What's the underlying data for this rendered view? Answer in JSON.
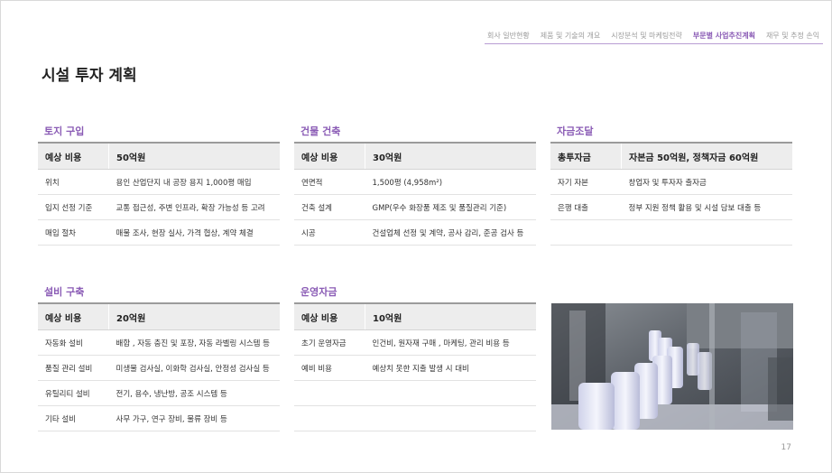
{
  "nav": [
    "회사 일반현황",
    "제품 및 기술의 개요",
    "시장분석 및 마케팅전략",
    "부문별 사업추진계획",
    "재무 및 추정 손익"
  ],
  "nav_active_index": 3,
  "accent_color": "#8a5bb5",
  "page_title": "시설 투자 계획",
  "land": {
    "title": "토지 구입",
    "head": [
      "예상 비용",
      "50억원"
    ],
    "rows": [
      [
        "위치",
        "용인 산업단지 내 공장 용지 1,000평 매입"
      ],
      [
        "입지 선정 기준",
        "교통 접근성, 주변 인프라, 확장 가능성 등 고려"
      ],
      [
        "매입 절차",
        "매물 조사, 현장 실사, 가격 협상, 계약 체결"
      ]
    ]
  },
  "building": {
    "title": "건물 건축",
    "head": [
      "예상 비용",
      "30억원"
    ],
    "rows": [
      [
        "연면적",
        "1,500평 (4,958m²)"
      ],
      [
        "건축 설계",
        "GMP(우수 화장품 제조 및 품질관리 기준)"
      ],
      [
        "시공",
        "건설업체 선정 및 계약, 공사 감리, 준공 검사 등"
      ]
    ]
  },
  "funding": {
    "title": "자금조달",
    "head": [
      "총투자금",
      "자본금 50억원, 정책자금 60억원"
    ],
    "rows": [
      [
        "자기 자본",
        "창업자 및 투자자 출자금"
      ],
      [
        "은행 대출",
        "정부 지원 정책 활용 및 시설 담보 대출 등"
      ],
      [
        "",
        ""
      ]
    ]
  },
  "equipment": {
    "title": "설비 구축",
    "head": [
      "예상 비용",
      "20억원"
    ],
    "rows": [
      [
        "자동화 설비",
        "배합 , 자동 충진 및 포장, 자동 라벨링 시스템 등"
      ],
      [
        "품질 관리 설비",
        "미생물 검사실, 이화학 검사실, 안정성 검사실 등"
      ],
      [
        "유틸리티 설비",
        "전기, 용수, 냉난방, 공조 시스템 등"
      ],
      [
        "기타 설비",
        "사무 가구, 연구 장비, 물류 장비 등"
      ]
    ]
  },
  "operating": {
    "title": "운영자금",
    "head": [
      "예상 비용",
      "10억원"
    ],
    "rows": [
      [
        "초기 운영자금",
        "인건비, 원자재 구매 , 마케팅, 관리 비용 등"
      ],
      [
        "예비 비용",
        "예상치 못한 지출 발생 시 대비"
      ],
      [
        "",
        ""
      ],
      [
        "",
        ""
      ]
    ]
  },
  "page_number": "17"
}
